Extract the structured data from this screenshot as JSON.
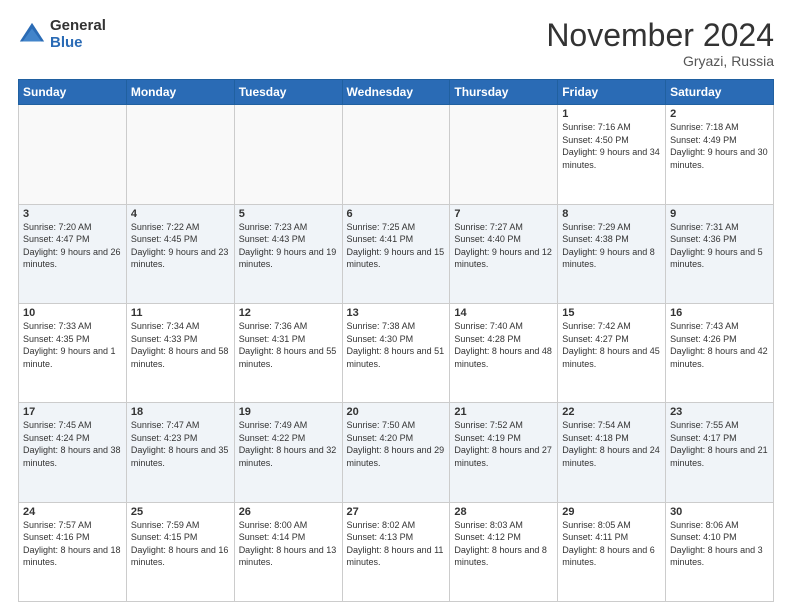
{
  "logo": {
    "general": "General",
    "blue": "Blue"
  },
  "header": {
    "month": "November 2024",
    "location": "Gryazi, Russia"
  },
  "days_of_week": [
    "Sunday",
    "Monday",
    "Tuesday",
    "Wednesday",
    "Thursday",
    "Friday",
    "Saturday"
  ],
  "weeks": [
    {
      "shaded": false,
      "days": [
        {
          "date": "",
          "info": ""
        },
        {
          "date": "",
          "info": ""
        },
        {
          "date": "",
          "info": ""
        },
        {
          "date": "",
          "info": ""
        },
        {
          "date": "",
          "info": ""
        },
        {
          "date": "1",
          "info": "Sunrise: 7:16 AM\nSunset: 4:50 PM\nDaylight: 9 hours and 34 minutes."
        },
        {
          "date": "2",
          "info": "Sunrise: 7:18 AM\nSunset: 4:49 PM\nDaylight: 9 hours and 30 minutes."
        }
      ]
    },
    {
      "shaded": true,
      "days": [
        {
          "date": "3",
          "info": "Sunrise: 7:20 AM\nSunset: 4:47 PM\nDaylight: 9 hours and 26 minutes."
        },
        {
          "date": "4",
          "info": "Sunrise: 7:22 AM\nSunset: 4:45 PM\nDaylight: 9 hours and 23 minutes."
        },
        {
          "date": "5",
          "info": "Sunrise: 7:23 AM\nSunset: 4:43 PM\nDaylight: 9 hours and 19 minutes."
        },
        {
          "date": "6",
          "info": "Sunrise: 7:25 AM\nSunset: 4:41 PM\nDaylight: 9 hours and 15 minutes."
        },
        {
          "date": "7",
          "info": "Sunrise: 7:27 AM\nSunset: 4:40 PM\nDaylight: 9 hours and 12 minutes."
        },
        {
          "date": "8",
          "info": "Sunrise: 7:29 AM\nSunset: 4:38 PM\nDaylight: 9 hours and 8 minutes."
        },
        {
          "date": "9",
          "info": "Sunrise: 7:31 AM\nSunset: 4:36 PM\nDaylight: 9 hours and 5 minutes."
        }
      ]
    },
    {
      "shaded": false,
      "days": [
        {
          "date": "10",
          "info": "Sunrise: 7:33 AM\nSunset: 4:35 PM\nDaylight: 9 hours and 1 minute."
        },
        {
          "date": "11",
          "info": "Sunrise: 7:34 AM\nSunset: 4:33 PM\nDaylight: 8 hours and 58 minutes."
        },
        {
          "date": "12",
          "info": "Sunrise: 7:36 AM\nSunset: 4:31 PM\nDaylight: 8 hours and 55 minutes."
        },
        {
          "date": "13",
          "info": "Sunrise: 7:38 AM\nSunset: 4:30 PM\nDaylight: 8 hours and 51 minutes."
        },
        {
          "date": "14",
          "info": "Sunrise: 7:40 AM\nSunset: 4:28 PM\nDaylight: 8 hours and 48 minutes."
        },
        {
          "date": "15",
          "info": "Sunrise: 7:42 AM\nSunset: 4:27 PM\nDaylight: 8 hours and 45 minutes."
        },
        {
          "date": "16",
          "info": "Sunrise: 7:43 AM\nSunset: 4:26 PM\nDaylight: 8 hours and 42 minutes."
        }
      ]
    },
    {
      "shaded": true,
      "days": [
        {
          "date": "17",
          "info": "Sunrise: 7:45 AM\nSunset: 4:24 PM\nDaylight: 8 hours and 38 minutes."
        },
        {
          "date": "18",
          "info": "Sunrise: 7:47 AM\nSunset: 4:23 PM\nDaylight: 8 hours and 35 minutes."
        },
        {
          "date": "19",
          "info": "Sunrise: 7:49 AM\nSunset: 4:22 PM\nDaylight: 8 hours and 32 minutes."
        },
        {
          "date": "20",
          "info": "Sunrise: 7:50 AM\nSunset: 4:20 PM\nDaylight: 8 hours and 29 minutes."
        },
        {
          "date": "21",
          "info": "Sunrise: 7:52 AM\nSunset: 4:19 PM\nDaylight: 8 hours and 27 minutes."
        },
        {
          "date": "22",
          "info": "Sunrise: 7:54 AM\nSunset: 4:18 PM\nDaylight: 8 hours and 24 minutes."
        },
        {
          "date": "23",
          "info": "Sunrise: 7:55 AM\nSunset: 4:17 PM\nDaylight: 8 hours and 21 minutes."
        }
      ]
    },
    {
      "shaded": false,
      "days": [
        {
          "date": "24",
          "info": "Sunrise: 7:57 AM\nSunset: 4:16 PM\nDaylight: 8 hours and 18 minutes."
        },
        {
          "date": "25",
          "info": "Sunrise: 7:59 AM\nSunset: 4:15 PM\nDaylight: 8 hours and 16 minutes."
        },
        {
          "date": "26",
          "info": "Sunrise: 8:00 AM\nSunset: 4:14 PM\nDaylight: 8 hours and 13 minutes."
        },
        {
          "date": "27",
          "info": "Sunrise: 8:02 AM\nSunset: 4:13 PM\nDaylight: 8 hours and 11 minutes."
        },
        {
          "date": "28",
          "info": "Sunrise: 8:03 AM\nSunset: 4:12 PM\nDaylight: 8 hours and 8 minutes."
        },
        {
          "date": "29",
          "info": "Sunrise: 8:05 AM\nSunset: 4:11 PM\nDaylight: 8 hours and 6 minutes."
        },
        {
          "date": "30",
          "info": "Sunrise: 8:06 AM\nSunset: 4:10 PM\nDaylight: 8 hours and 3 minutes."
        }
      ]
    }
  ]
}
